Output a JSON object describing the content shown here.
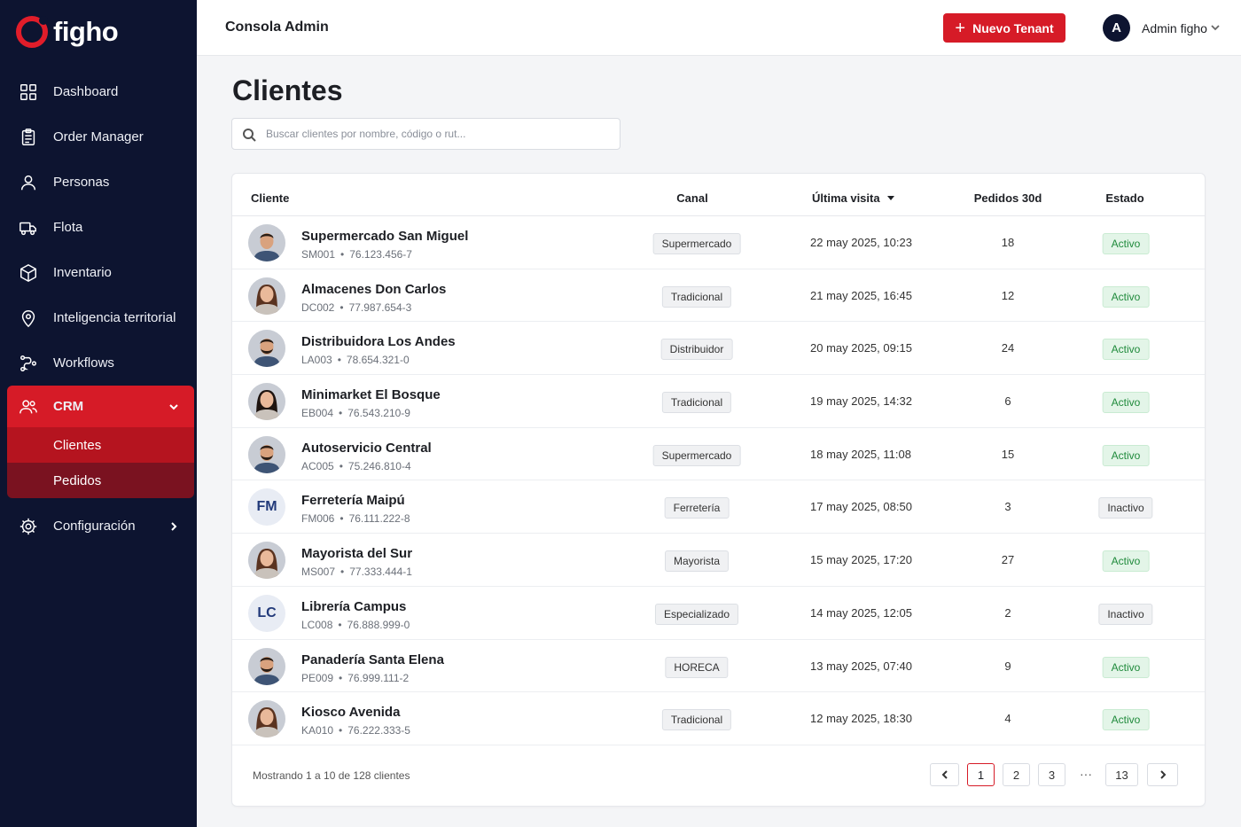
{
  "brand": {
    "name": "figho",
    "accent": "#d61b27"
  },
  "sidebar": {
    "items": [
      {
        "label": "Dashboard",
        "icon": "dashboard-icon"
      },
      {
        "label": "Order Manager",
        "icon": "clipboard-icon"
      },
      {
        "label": "Personas",
        "icon": "user-icon"
      },
      {
        "label": "Flota",
        "icon": "truck-icon"
      },
      {
        "label": "Inventario",
        "icon": "box-icon"
      },
      {
        "label": "Inteligencia territorial",
        "icon": "map-pin-icon"
      },
      {
        "label": "Workflows",
        "icon": "workflow-icon"
      },
      {
        "label": "CRM",
        "icon": "users-icon",
        "active": true
      },
      {
        "label": "Configuración",
        "icon": "gear-icon"
      }
    ],
    "crm_sub": [
      {
        "label": "Clientes",
        "active": true
      },
      {
        "label": "Pedidos"
      }
    ]
  },
  "header": {
    "title": "Consola Admin",
    "new_button": "Nuevo Tenant",
    "avatar_initial": "A",
    "user_name": "Admin figho"
  },
  "main": {
    "title": "Clientes",
    "search_placeholder": "Buscar clientes por nombre, código o rut...",
    "columns": {
      "cliente": "Cliente",
      "canal": "Canal",
      "visita": "Última visita",
      "pedidos": "Pedidos 30d",
      "estado": "Estado"
    },
    "rows": [
      {
        "name": "Supermercado San Miguel",
        "code": "SM001",
        "rut": "76.123.456-7",
        "canal": "Supermercado",
        "visita": "22 may 2025, 10:23",
        "pedidos": "18",
        "estado": "Activo",
        "avatar": "man"
      },
      {
        "name": "Almacenes Don Carlos",
        "code": "DC002",
        "rut": "77.987.654-3",
        "canal": "Tradicional",
        "visita": "21 may 2025, 16:45",
        "pedidos": "12",
        "estado": "Activo",
        "avatar": "woman"
      },
      {
        "name": "Distribuidora Los Andes",
        "code": "LA003",
        "rut": "78.654.321-0",
        "canal": "Distribuidor",
        "visita": "20 may 2025, 09:15",
        "pedidos": "24",
        "estado": "Activo",
        "avatar": "man-beard"
      },
      {
        "name": "Minimarket El Bosque",
        "code": "EB004",
        "rut": "76.543.210-9",
        "canal": "Tradicional",
        "visita": "19 may 2025, 14:32",
        "pedidos": "6",
        "estado": "Activo",
        "avatar": "woman-dark"
      },
      {
        "name": "Autoservicio Central",
        "code": "AC005",
        "rut": "75.246.810-4",
        "canal": "Supermercado",
        "visita": "18 may 2025, 11:08",
        "pedidos": "15",
        "estado": "Activo",
        "avatar": "man-beard"
      },
      {
        "name": "Ferretería Maipú",
        "code": "FM006",
        "rut": "76.111.222-8",
        "canal": "Ferretería",
        "visita": "17 may 2025, 08:50",
        "pedidos": "3",
        "estado": "Inactivo",
        "avatar": "initials",
        "initials": "FM"
      },
      {
        "name": "Mayorista del Sur",
        "code": "MS007",
        "rut": "77.333.444-1",
        "canal": "Mayorista",
        "visita": "15 may 2025, 17:20",
        "pedidos": "27",
        "estado": "Activo",
        "avatar": "woman"
      },
      {
        "name": "Librería Campus",
        "code": "LC008",
        "rut": "76.888.999-0",
        "canal": "Especializado",
        "visita": "14 may 2025, 12:05",
        "pedidos": "2",
        "estado": "Inactivo",
        "avatar": "initials",
        "initials": "LC"
      },
      {
        "name": "Panadería Santa Elena",
        "code": "PE009",
        "rut": "76.999.111-2",
        "canal": "HORECA",
        "visita": "13 may 2025, 07:40",
        "pedidos": "9",
        "estado": "Activo",
        "avatar": "man-beard"
      },
      {
        "name": "Kiosco Avenida",
        "code": "KA010",
        "rut": "76.222.333-5",
        "canal": "Tradicional",
        "visita": "12 may 2025, 18:30",
        "pedidos": "4",
        "estado": "Activo",
        "avatar": "woman"
      }
    ],
    "footer_text": "Mostrando 1 a 10 de 128 clientes",
    "pages": [
      "1",
      "2",
      "3",
      "13"
    ],
    "ellipsis": "···"
  }
}
